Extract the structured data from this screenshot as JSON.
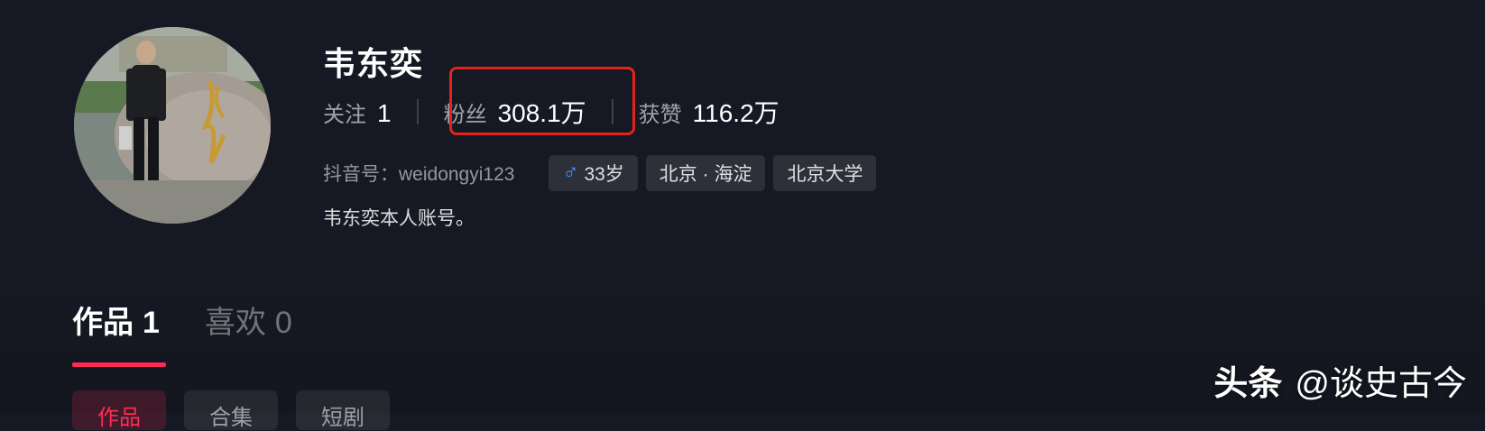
{
  "profile": {
    "name": "韦东奕",
    "douyin_id": "抖音号：weidongyi123",
    "bio": "韦东奕本人账号。"
  },
  "stats": [
    {
      "label": "关注",
      "value": "1"
    },
    {
      "label": "粉丝",
      "value": "308.1万"
    },
    {
      "label": "获赞",
      "value": "116.2万"
    }
  ],
  "tags": {
    "gender_icon": "male-icon",
    "age": "33岁",
    "location": "北京 · 海淀",
    "school": "北京大学"
  },
  "tabs": [
    {
      "label": "作品",
      "count": "1"
    },
    {
      "label": "喜欢",
      "count": "0"
    }
  ],
  "subtabs": [
    "作品",
    "合集",
    "短剧"
  ],
  "watermark": {
    "brand": "头条",
    "handle": "@谈史古今"
  },
  "colors": {
    "background": "#161823",
    "accent": "#fe2c55",
    "highlight_box": "#e0241b",
    "male": "#3d9bff"
  }
}
